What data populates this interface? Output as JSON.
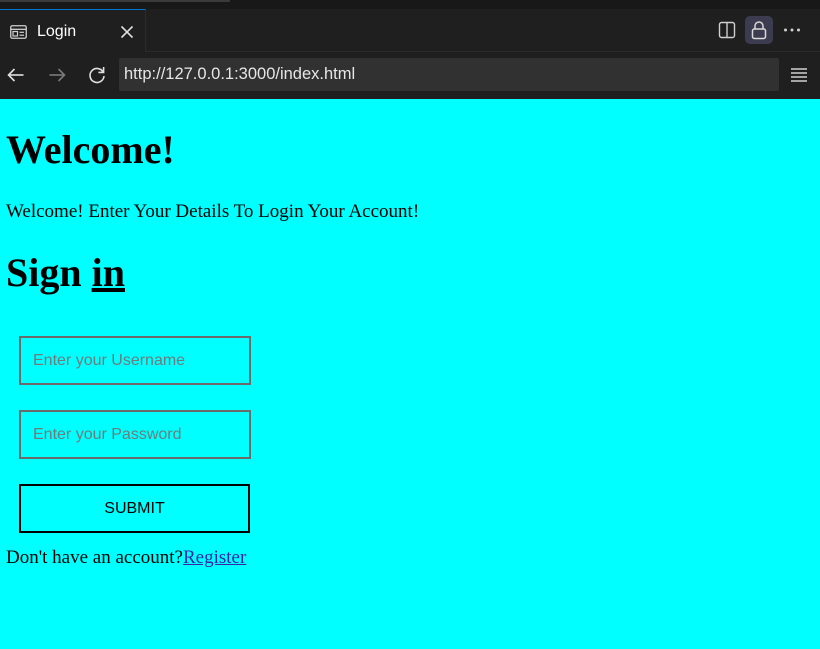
{
  "browser": {
    "tab": {
      "title": "Login",
      "icon": "page-layout-icon"
    },
    "address": {
      "url": "http://127.0.0.1:3000/index.html"
    },
    "actions": [
      "split-view-icon",
      "lock-icon",
      "more-icon"
    ],
    "nav_icons": [
      "back-arrow-icon",
      "forward-arrow-icon",
      "reload-icon",
      "hamburger-menu-icon"
    ]
  },
  "page": {
    "background": "#00ffff",
    "heading": "Welcome!",
    "intro": "Welcome! Enter Your Details To Login Your Account!",
    "signin": {
      "part1": "Sign ",
      "part2": "in"
    },
    "form": {
      "username_placeholder": "Enter your Username",
      "password_placeholder": "Enter your Password",
      "submit_label": "SUBMIT"
    },
    "register": {
      "prompt": "Don't have an account?",
      "link_label": "Register"
    }
  }
}
